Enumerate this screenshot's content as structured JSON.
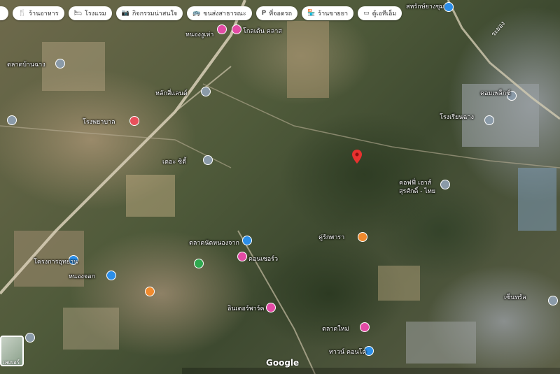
{
  "toolbar": {
    "chips": [
      {
        "icon": "restaurant-icon",
        "glyph": "🍴",
        "label": "ร้านอาหาร"
      },
      {
        "icon": "hotel-icon",
        "glyph": "🛏",
        "label": "โรงแรม"
      },
      {
        "icon": "camera-icon",
        "glyph": "📷",
        "label": "กิจกรรมน่าสนใจ"
      },
      {
        "icon": "bus-icon",
        "glyph": "🚌",
        "label": "ขนส่งสาธารณะ"
      },
      {
        "icon": "parking-icon",
        "glyph": "P",
        "label": "ที่จอดรถ"
      },
      {
        "icon": "pharmacy-icon",
        "glyph": "🏪",
        "label": "ร้านขายยา"
      },
      {
        "icon": "atm-icon",
        "glyph": "▭",
        "label": "ตู้เอทีเอ็ม"
      }
    ]
  },
  "map": {
    "road_label": "ระยอง",
    "google": "Google",
    "scale_label": "เลเยอร์",
    "colors": {
      "hospital": "#e8505b",
      "shopping": "#e24ba5",
      "place": "#2b8ee8",
      "food": "#f08a2e",
      "park": "#2fa84f",
      "marker": "#e8312f"
    },
    "pois": [
      {
        "kind": "place",
        "label": "สหรักษ์ยางชุม"
      },
      {
        "kind": "place",
        "label": "หนองงูเห่า"
      },
      {
        "kind": "shopping",
        "label": "โกลเด้น คลาส"
      },
      {
        "kind": "hospital",
        "label": "โรงพยาบาล"
      },
      {
        "kind": "place",
        "label": "หลักสี่แลนด์"
      },
      {
        "kind": "place",
        "label": "ตลาดบ้านฉาง"
      },
      {
        "kind": "place",
        "label": "เดอะ ซิตี้"
      },
      {
        "kind": "place",
        "label": "โรงเรียนฉาง"
      },
      {
        "kind": "shopping",
        "label": "คอมเพล็กซ์"
      },
      {
        "kind": "place",
        "label": "คอฟฟี่ เฮาส์"
      },
      {
        "kind": "place",
        "label": "สุรศักดิ์ - ไทย"
      },
      {
        "kind": "food",
        "label": "คู่รักพารา"
      },
      {
        "kind": "shopping",
        "label": "ตลาดนัดหนองจาก"
      },
      {
        "kind": "shopping",
        "label": "คอนเซอร์ว"
      },
      {
        "kind": "place",
        "label": "โครงการอุทยาน"
      },
      {
        "kind": "place",
        "label": "หนองจอก"
      },
      {
        "kind": "place",
        "label": "อินเตอร์พาร์ค"
      },
      {
        "kind": "shopping",
        "label": "ตลาดใหม่"
      },
      {
        "kind": "place",
        "label": "ทาวน์ คอนโด"
      },
      {
        "kind": "place",
        "label": "เซ็นทรัล"
      }
    ]
  }
}
